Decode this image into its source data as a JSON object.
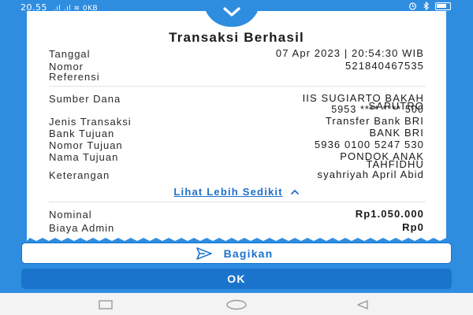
{
  "status_bar": {
    "time": "20.55",
    "network": ".ıl .ıl ≋ 0KB"
  },
  "receipt": {
    "title": "Transaksi Berhasil",
    "rows": [
      {
        "label": "Tanggal",
        "value": "07 Apr 2023 | 20:54:30 WIB"
      },
      {
        "label": "Nomor\nReferensi",
        "value": "521840467535"
      },
      {
        "label": "Sumber Dana",
        "value_line1": "IIS SUGIARTO BAKAH",
        "value_line2": "SAPUTRO",
        "value_line3": "5953 **** **** 500"
      },
      {
        "label": "Jenis Transaksi",
        "value": "Transfer Bank BRI"
      },
      {
        "label": "Bank Tujuan",
        "value": "BANK BRI"
      },
      {
        "label": "Nomor Tujuan",
        "value": "5936 0100 5247 530"
      },
      {
        "label": "Nama Tujuan",
        "value_line1": "PONDOK ANAK",
        "value_line2": "TAHFIDHU"
      },
      {
        "label": "Keterangan",
        "value": "syahriyah April Abid"
      }
    ],
    "toggle_label": "Lihat Lebih Sedikit",
    "nominal_label": "Nominal",
    "nominal_value": "Rp1.050.000",
    "admin_label": "Biaya Admin",
    "admin_value": "Rp0"
  },
  "actions": {
    "share_label": "Bagikan",
    "ok_label": "OK"
  },
  "colors": {
    "background": "#2f8de0",
    "primary": "#1a74cc",
    "link": "#1e70c8"
  },
  "icons": {
    "collapse": "chevron-down-icon",
    "toggle": "chevron-up-icon",
    "share": "send-icon",
    "nav": [
      "recents-square-icon",
      "home-circle-icon",
      "back-triangle-icon"
    ]
  }
}
